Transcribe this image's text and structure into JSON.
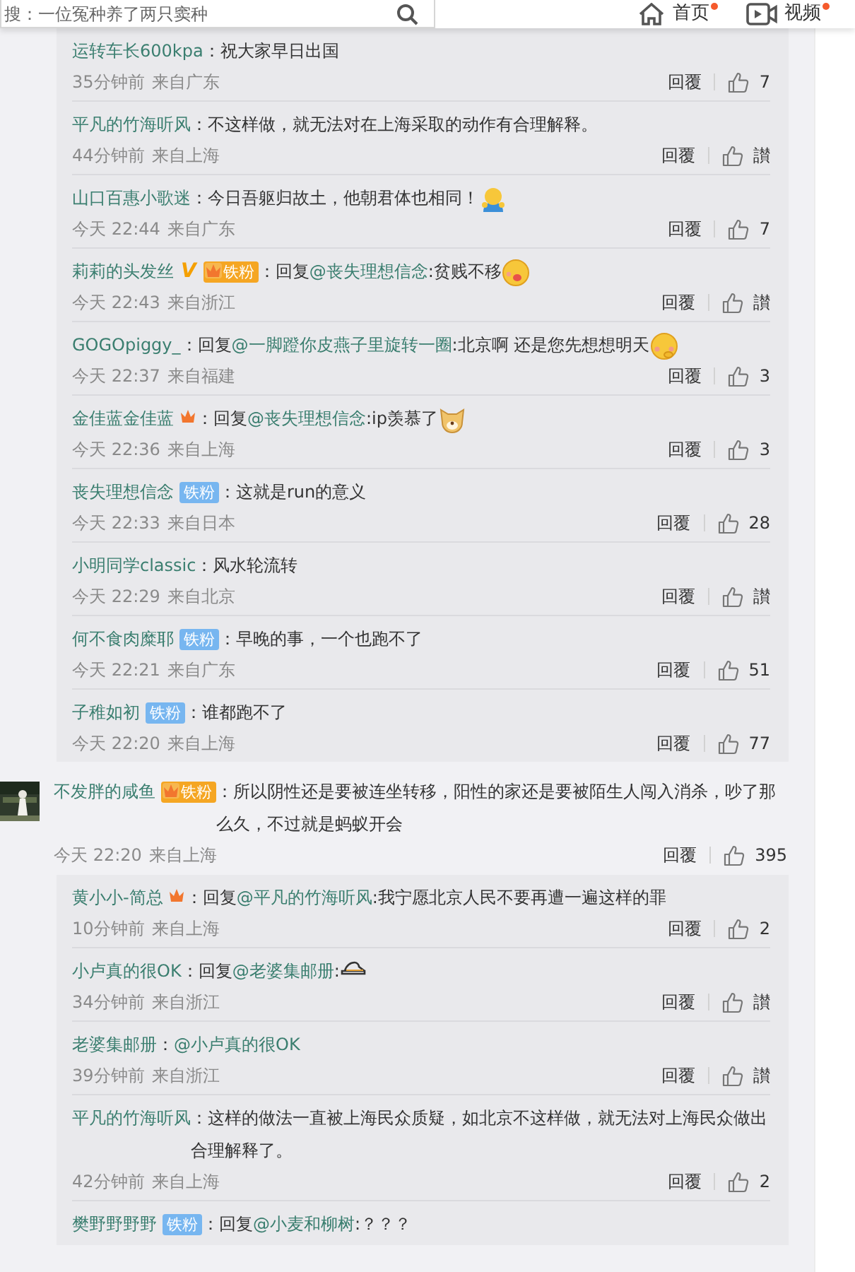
{
  "header": {
    "search": {
      "placeholder": "搜：一位冤种养了两只窦种"
    },
    "nav": [
      {
        "label": "首页",
        "unread": true
      },
      {
        "label": "视频",
        "unread": true
      }
    ]
  },
  "thread_replies": [
    {
      "author": "运转车长600kpa",
      "body": [
        {
          "kind": "text",
          "text": "：祝大家早日出国"
        }
      ],
      "time": "35分钟前",
      "location": "来自广东",
      "reply_label": "回覆",
      "likes": "7"
    },
    {
      "author": "平凡的竹海听风",
      "body": [
        {
          "kind": "text",
          "text": "：不这样做，就无法对在上海采取的动作有合理解释。"
        }
      ],
      "time": "44分钟前",
      "location": "来自上海",
      "reply_label": "回覆",
      "likes": "讃"
    },
    {
      "author": "山口百惠小歌迷",
      "body": [
        {
          "kind": "text",
          "text": "：今日吾躯归故土，他朝君体也相同！"
        }
      ],
      "emoji": {
        "kind": "hug"
      },
      "time": "今天 22:44",
      "location": "来自广东",
      "reply_label": "回覆",
      "likes": "7"
    },
    {
      "author": "莉莉的头发丝",
      "badges": [
        {
          "kind": "vip",
          "label": "V"
        },
        {
          "kind": "fan_crown",
          "label": "铁粉"
        }
      ],
      "body": [
        {
          "kind": "text",
          "text": "：回复"
        },
        {
          "kind": "mention",
          "text": "@丧失理想信念"
        },
        {
          "kind": "text",
          "text": ":贫贱不移"
        }
      ],
      "emoji": {
        "kind": "yum"
      },
      "time": "今天 22:43",
      "location": "来自浙江",
      "reply_label": "回覆",
      "likes": "讃"
    },
    {
      "author": "GOGOpiggy_",
      "body": [
        {
          "kind": "text",
          "text": "：回复"
        },
        {
          "kind": "mention",
          "text": "@一脚蹬你皮燕子里旋转一圈"
        },
        {
          "kind": "text",
          "text": ":北京啊 还是您先想想明天"
        }
      ],
      "emoji": {
        "kind": "shy"
      },
      "time": "今天 22:37",
      "location": "来自福建",
      "reply_label": "回覆",
      "likes": "3"
    },
    {
      "author": "金佳蓝金佳蓝",
      "badges": [
        {
          "kind": "crown"
        }
      ],
      "body": [
        {
          "kind": "text",
          "text": "：回复"
        },
        {
          "kind": "mention",
          "text": "@丧失理想信念"
        },
        {
          "kind": "text",
          "text": ":ip羡慕了"
        }
      ],
      "emoji": {
        "kind": "dog"
      },
      "time": "今天 22:36",
      "location": "来自上海",
      "reply_label": "回覆",
      "likes": "3"
    },
    {
      "author": "丧失理想信念",
      "badges": [
        {
          "kind": "fan",
          "label": "铁粉"
        }
      ],
      "body": [
        {
          "kind": "text",
          "text": "：这就是run的意义"
        }
      ],
      "time": "今天 22:33",
      "location": "来自日本",
      "reply_label": "回覆",
      "likes": "28"
    },
    {
      "author": "小明同学classic",
      "body": [
        {
          "kind": "text",
          "text": "：风水轮流转"
        }
      ],
      "time": "今天 22:29",
      "location": "来自北京",
      "reply_label": "回覆",
      "likes": "讃"
    },
    {
      "author": "何不食肉糜耶",
      "badges": [
        {
          "kind": "fan",
          "label": "铁粉"
        }
      ],
      "body": [
        {
          "kind": "text",
          "text": "：早晚的事，一个也跑不了"
        }
      ],
      "time": "今天 22:21",
      "location": "来自广东",
      "reply_label": "回覆",
      "likes": "51"
    },
    {
      "author": "子稚如初",
      "badges": [
        {
          "kind": "fan",
          "label": "铁粉"
        }
      ],
      "body": [
        {
          "kind": "text",
          "text": "：谁都跑不了"
        }
      ],
      "time": "今天 22:20",
      "location": "来自上海",
      "reply_label": "回覆",
      "likes": "77"
    }
  ],
  "comment": {
    "author": "不发胖的咸鱼",
    "badges": [
      {
        "kind": "fan_crown",
        "label": "铁粉"
      }
    ],
    "body": [
      {
        "kind": "text",
        "text": "：所以阴性还是要被连坐转移，阳性的家还是要被陌生人闯入消杀，吵了那么久，不过就是蚂蚁开会"
      }
    ],
    "time": "今天 22:20",
    "location": "来自上海",
    "reply_label": "回覆",
    "likes": "395",
    "replies": [
      {
        "author": "黄小小-简总",
        "badges": [
          {
            "kind": "crown"
          }
        ],
        "body": [
          {
            "kind": "text",
            "text": "：回复"
          },
          {
            "kind": "mention",
            "text": "@平凡的竹海听风"
          },
          {
            "kind": "text",
            "text": ":我宁愿北京人民不要再遭一遍这样的罪"
          }
        ],
        "time": "10分钟前",
        "location": "来自上海",
        "reply_label": "回覆",
        "likes": "2"
      },
      {
        "author": "小卢真的很OK",
        "body": [
          {
            "kind": "text",
            "text": "：回复"
          },
          {
            "kind": "mention",
            "text": "@老婆集邮册"
          },
          {
            "kind": "text",
            "text": ":"
          }
        ],
        "emoji": {
          "kind": "shoe"
        },
        "time": "34分钟前",
        "location": "来自浙江",
        "reply_label": "回覆",
        "likes": "讃"
      },
      {
        "author": "老婆集邮册",
        "body": [
          {
            "kind": "text",
            "text": "："
          },
          {
            "kind": "mention",
            "text": "@小卢真的很OK"
          }
        ],
        "time": "39分钟前",
        "location": "来自浙江",
        "reply_label": "回覆",
        "likes": "讃"
      },
      {
        "author": "平凡的竹海听风",
        "body": [
          {
            "kind": "text",
            "text": "：这样的做法一直被上海民众质疑，如北京不这样做，就无法对上海民众做出合理解释了。"
          }
        ],
        "time": "42分钟前",
        "location": "来自上海",
        "reply_label": "回覆",
        "likes": "2"
      },
      {
        "author": "樊野野野野",
        "badges": [
          {
            "kind": "fan",
            "label": "铁粉"
          }
        ],
        "body": [
          {
            "kind": "text",
            "text": "：回复"
          },
          {
            "kind": "mention",
            "text": "@小麦和柳树"
          },
          {
            "kind": "text",
            "text": ":？？？"
          }
        ]
      }
    ]
  }
}
